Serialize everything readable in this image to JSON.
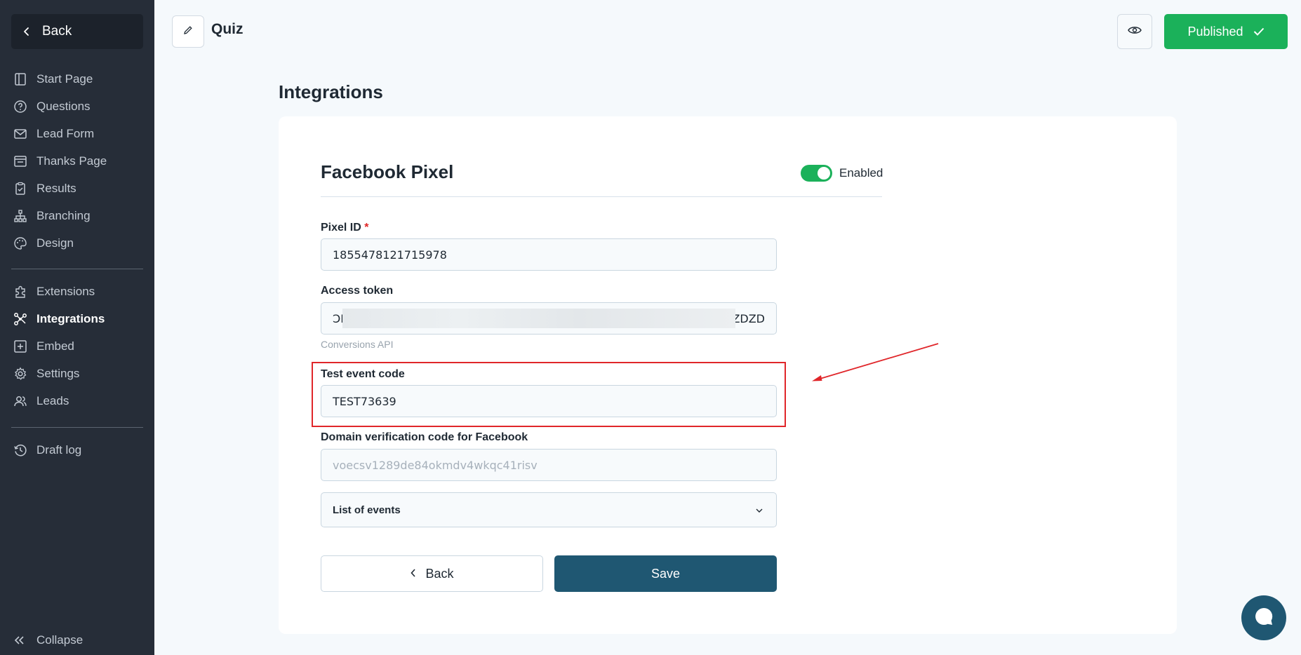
{
  "sidebar": {
    "back_label": "Back",
    "items": [
      {
        "label": "Start Page",
        "icon": "page-icon"
      },
      {
        "label": "Questions",
        "icon": "question-circle-icon"
      },
      {
        "label": "Lead Form",
        "icon": "mail-icon"
      },
      {
        "label": "Thanks Page",
        "icon": "thanks-page-icon"
      },
      {
        "label": "Results",
        "icon": "clipboard-icon"
      },
      {
        "label": "Branching",
        "icon": "branching-icon"
      },
      {
        "label": "Design",
        "icon": "palette-icon"
      }
    ],
    "items2": [
      {
        "label": "Extensions",
        "icon": "puzzle-icon"
      },
      {
        "label": "Integrations",
        "icon": "integrations-icon",
        "active": true
      },
      {
        "label": "Embed",
        "icon": "embed-icon"
      },
      {
        "label": "Settings",
        "icon": "gear-icon"
      },
      {
        "label": "Leads",
        "icon": "users-icon"
      }
    ],
    "items3": [
      {
        "label": "Draft log",
        "icon": "history-icon"
      }
    ],
    "collapse_label": "Collapse"
  },
  "header": {
    "quiz_title": "Quiz",
    "publish_label": "Published"
  },
  "main": {
    "page_title": "Integrations",
    "section_title": "Facebook Pixel",
    "toggle_label": "Enabled",
    "toggle_on": true,
    "pixel_id": {
      "label": "Pixel ID",
      "required_mark": "*",
      "value": "1855478121715978"
    },
    "access_token": {
      "label": "Access token",
      "value_start": "ϽB",
      "value_end": "ZDZD",
      "helper": "Conversions API"
    },
    "test_event": {
      "label": "Test event code",
      "value": "TEST73639"
    },
    "domain_verification": {
      "label": "Domain verification code for Facebook",
      "placeholder": "voecsv1289de84okmdv4wkqc41risv"
    },
    "events_select": {
      "label": "List of events"
    },
    "back_label": "Back",
    "save_label": "Save"
  },
  "colors": {
    "sidebar_bg": "#262d38",
    "publish_green": "#1bb15a",
    "save_blue": "#1f5772",
    "highlight_red": "#e0262a"
  }
}
